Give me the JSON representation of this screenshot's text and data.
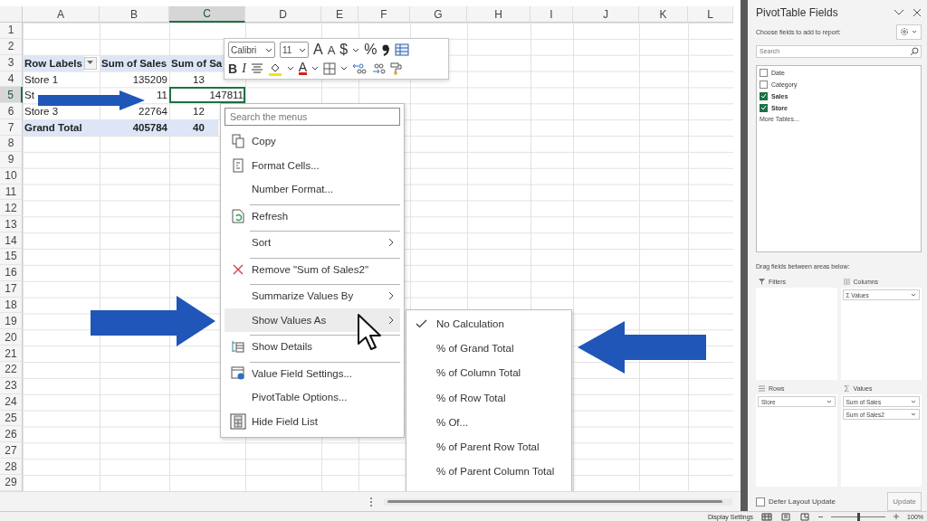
{
  "sheet": {
    "columns": [
      {
        "label": "A",
        "selected": false
      },
      {
        "label": "B",
        "selected": false
      },
      {
        "label": "C",
        "selected": true
      },
      {
        "label": "D",
        "selected": false
      },
      {
        "label": "E",
        "selected": false
      },
      {
        "label": "F",
        "selected": false
      },
      {
        "label": "G",
        "selected": false
      },
      {
        "label": "H",
        "selected": false
      },
      {
        "label": "I",
        "selected": false
      },
      {
        "label": "J",
        "selected": false
      },
      {
        "label": "K",
        "selected": false
      },
      {
        "label": "L",
        "selected": false
      }
    ],
    "rows": [
      {
        "label": "1",
        "selected": false
      },
      {
        "label": "2",
        "selected": false
      },
      {
        "label": "3",
        "selected": false,
        "kind": "header",
        "cells": [
          {
            "text": "Row Labels",
            "selected": false
          },
          {
            "text": "Sum of Sales",
            "selected": false
          },
          {
            "text": "Sum of Sa",
            "selected": false
          }
        ]
      },
      {
        "label": "4",
        "selected": false,
        "kind": "data",
        "cells": [
          {
            "text": "Store 1",
            "selected": false
          },
          {
            "text": "135209",
            "selected": false
          },
          {
            "text": "13",
            "selected": false
          }
        ]
      },
      {
        "label": "5",
        "selected": true,
        "kind": "data",
        "cells": [
          {
            "text": "St",
            "selected": false
          },
          {
            "text": "11",
            "selected": false
          },
          {
            "text": "147811",
            "selected": true
          }
        ]
      },
      {
        "label": "6",
        "selected": false,
        "kind": "data",
        "cells": [
          {
            "text": "Store 3",
            "selected": false
          },
          {
            "text": "22764",
            "selected": false
          },
          {
            "text": "12",
            "selected": false
          }
        ]
      },
      {
        "label": "7",
        "selected": false,
        "kind": "total",
        "cells": [
          {
            "text": "Grand Total",
            "selected": false
          },
          {
            "text": "405784",
            "selected": false
          },
          {
            "text": "40",
            "selected": false
          }
        ]
      },
      {
        "label": "8",
        "selected": false
      },
      {
        "label": "9",
        "selected": false
      },
      {
        "label": "10",
        "selected": false
      },
      {
        "label": "11",
        "selected": false
      },
      {
        "label": "12",
        "selected": false
      },
      {
        "label": "13",
        "selected": false
      },
      {
        "label": "14",
        "selected": false
      },
      {
        "label": "15",
        "selected": false
      },
      {
        "label": "16",
        "selected": false
      },
      {
        "label": "17",
        "selected": false
      },
      {
        "label": "18",
        "selected": false
      },
      {
        "label": "19",
        "selected": false
      },
      {
        "label": "20",
        "selected": false
      },
      {
        "label": "21",
        "selected": false
      },
      {
        "label": "22",
        "selected": false
      },
      {
        "label": "23",
        "selected": false
      },
      {
        "label": "24",
        "selected": false
      },
      {
        "label": "25",
        "selected": false
      },
      {
        "label": "26",
        "selected": false
      },
      {
        "label": "27",
        "selected": false
      },
      {
        "label": "28",
        "selected": false
      },
      {
        "label": "29",
        "selected": false
      }
    ]
  },
  "mini_toolbar": {
    "font": "Calibri",
    "size": "11",
    "row1_labels": [
      "A",
      "A",
      "$",
      "%"
    ],
    "row2_labels": [
      "B",
      "I",
      "A"
    ]
  },
  "context_menu": {
    "search": {
      "placeholder": "Search the menus"
    },
    "items": [
      {
        "label": "Copy",
        "divider_before": false,
        "submenu": false,
        "selected": false
      },
      {
        "label": "Format Cells...",
        "divider_before": false,
        "submenu": false,
        "selected": false
      },
      {
        "label": "Number Format...",
        "divider_before": false,
        "submenu": false,
        "selected": false
      },
      {
        "label": "Refresh",
        "divider_before": true,
        "submenu": false,
        "selected": false
      },
      {
        "label": "Sort",
        "divider_before": true,
        "submenu": true,
        "selected": false
      },
      {
        "label": "Remove \"Sum of Sales2\"",
        "divider_before": true,
        "submenu": false,
        "selected": false
      },
      {
        "label": "Summarize Values By",
        "divider_before": true,
        "submenu": true,
        "selected": false
      },
      {
        "label": "Show Values As",
        "divider_before": false,
        "submenu": true,
        "selected": true
      },
      {
        "label": "Show Details",
        "divider_before": true,
        "submenu": false,
        "selected": false
      },
      {
        "label": "Value Field Settings...",
        "divider_before": true,
        "submenu": false,
        "selected": false
      },
      {
        "label": "PivotTable Options...",
        "divider_before": false,
        "submenu": false,
        "selected": false
      },
      {
        "label": "Hide Field List",
        "divider_before": false,
        "submenu": false,
        "selected": false
      }
    ]
  },
  "submenu": {
    "items": [
      {
        "label": "No Calculation",
        "checked": true
      },
      {
        "label": "% of Grand Total",
        "checked": false
      },
      {
        "label": "% of Column Total",
        "checked": false
      },
      {
        "label": "% of Row Total",
        "checked": false
      },
      {
        "label": "% Of...",
        "checked": false
      },
      {
        "label": "% of Parent Row Total",
        "checked": false
      },
      {
        "label": "% of Parent Column Total",
        "checked": false
      }
    ]
  },
  "pivot_panel": {
    "title": "PivotTable Fields",
    "subtitle": "Choose fields to add to report:",
    "search": {
      "placeholder": "Search"
    },
    "fields": [
      {
        "label": "Date",
        "checked": false
      },
      {
        "label": "Category",
        "checked": false
      },
      {
        "label": "Sales",
        "checked": true
      },
      {
        "label": "Store",
        "checked": true
      }
    ],
    "more_tables": "More Tables...",
    "drag_hint": "Drag fields between areas below:",
    "areas": [
      {
        "title": "Filters"
      },
      {
        "title": "Columns",
        "items": [
          "Σ Values"
        ]
      },
      {
        "title": "Rows",
        "items": [
          "Store"
        ]
      },
      {
        "title": "Values",
        "items": [
          "Sum of Sales",
          "Sum of Sales2"
        ]
      }
    ],
    "defer": {
      "label": "Defer Layout Update",
      "checked": false
    },
    "update_button": {
      "label": "Update",
      "disabled": true
    }
  },
  "status_bar": {
    "display_settings": "Display Settings",
    "zoom": {
      "level": 0.5,
      "reading": "100%"
    }
  }
}
